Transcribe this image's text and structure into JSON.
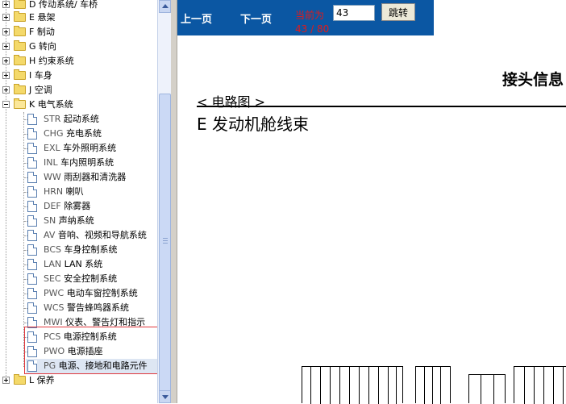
{
  "tree": {
    "top_items": [
      {
        "label": "D 传动系统/ 车桥",
        "expanded": false
      },
      {
        "label": "E 悬架",
        "expanded": false
      },
      {
        "label": "F 制动",
        "expanded": false
      },
      {
        "label": "G 转向",
        "expanded": false
      },
      {
        "label": "H 约束系统",
        "expanded": false
      },
      {
        "label": "I 车身",
        "expanded": false
      },
      {
        "label": "J 空调",
        "expanded": false
      },
      {
        "label": "K 电气系统",
        "expanded": true
      }
    ],
    "children": [
      {
        "code": "STR",
        "name": "起动系统"
      },
      {
        "code": "CHG",
        "name": "充电系统"
      },
      {
        "code": "EXL",
        "name": "车外照明系统"
      },
      {
        "code": "INL",
        "name": "车内照明系统"
      },
      {
        "code": "WW",
        "name": "雨刮器和清洗器"
      },
      {
        "code": "HRN",
        "name": "喇叭"
      },
      {
        "code": "DEF",
        "name": "除雾器"
      },
      {
        "code": "SN",
        "name": "声纳系统"
      },
      {
        "code": "AV",
        "name": "音响、视频和导航系统"
      },
      {
        "code": "BCS",
        "name": "车身控制系统"
      },
      {
        "code": "LAN",
        "name": "LAN 系统"
      },
      {
        "code": "SEC",
        "name": "安全控制系统"
      },
      {
        "code": "PWC",
        "name": "电动车窗控制系统"
      },
      {
        "code": "WCS",
        "name": "警告蜂鸣器系统"
      },
      {
        "code": "MWI",
        "name": "仪表、警告灯和指示"
      },
      {
        "code": "PCS",
        "name": "电源控制系统"
      },
      {
        "code": "PWO",
        "name": "电源插座"
      },
      {
        "code": "PG",
        "name": "电源、接地和电路元件"
      }
    ],
    "last_item": {
      "label": "L 保养",
      "expanded": false
    }
  },
  "toolbar": {
    "prev_label": "上一页",
    "next_label": "下一页",
    "current_label": "当前为",
    "page_value": "43",
    "page_count": "43 / 80",
    "jump_label": "跳转"
  },
  "content": {
    "heading": "接头信息",
    "diagram_label": "< 电路图 >",
    "section_title": "E 发动机舱线束"
  },
  "colors": {
    "toolbar_bg": "#0b57a3",
    "page_text": "#e21a1a",
    "selection_border": "#e0383e"
  }
}
